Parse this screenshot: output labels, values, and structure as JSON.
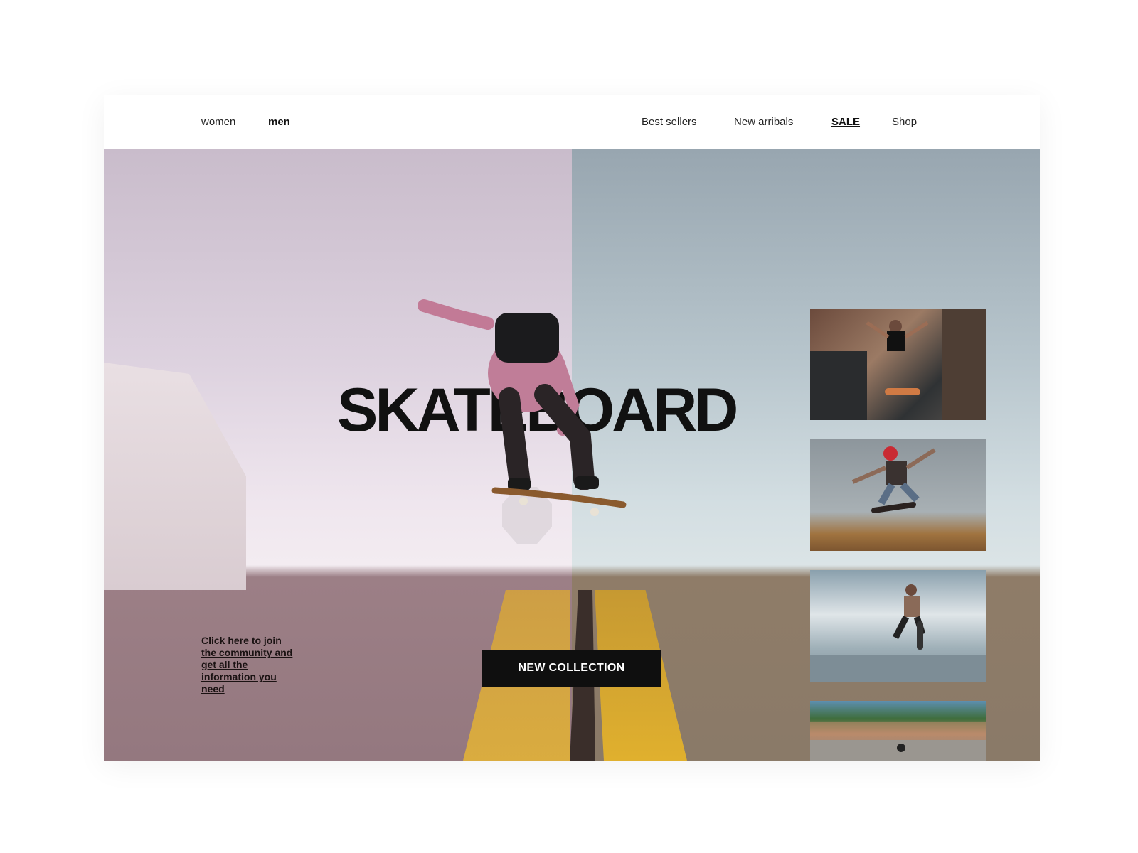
{
  "nav": {
    "left": [
      "women",
      "men"
    ],
    "right": [
      "Best sellers",
      "New arribals",
      "SALE",
      "Shop"
    ]
  },
  "hero": {
    "title": "SKATEBOARD",
    "join_text": "Click here to join the community and get all the information you need",
    "cta_label": "NEW COLLECTION"
  },
  "thumbnails": [
    "street-skater-photo",
    "red-cap-skater-photo",
    "bowl-skater-photo",
    "skatepark-crowd-photo"
  ],
  "colors": {
    "cta_bg": "#0f0f0f",
    "cta_text": "#ffffff",
    "title": "#111111"
  }
}
